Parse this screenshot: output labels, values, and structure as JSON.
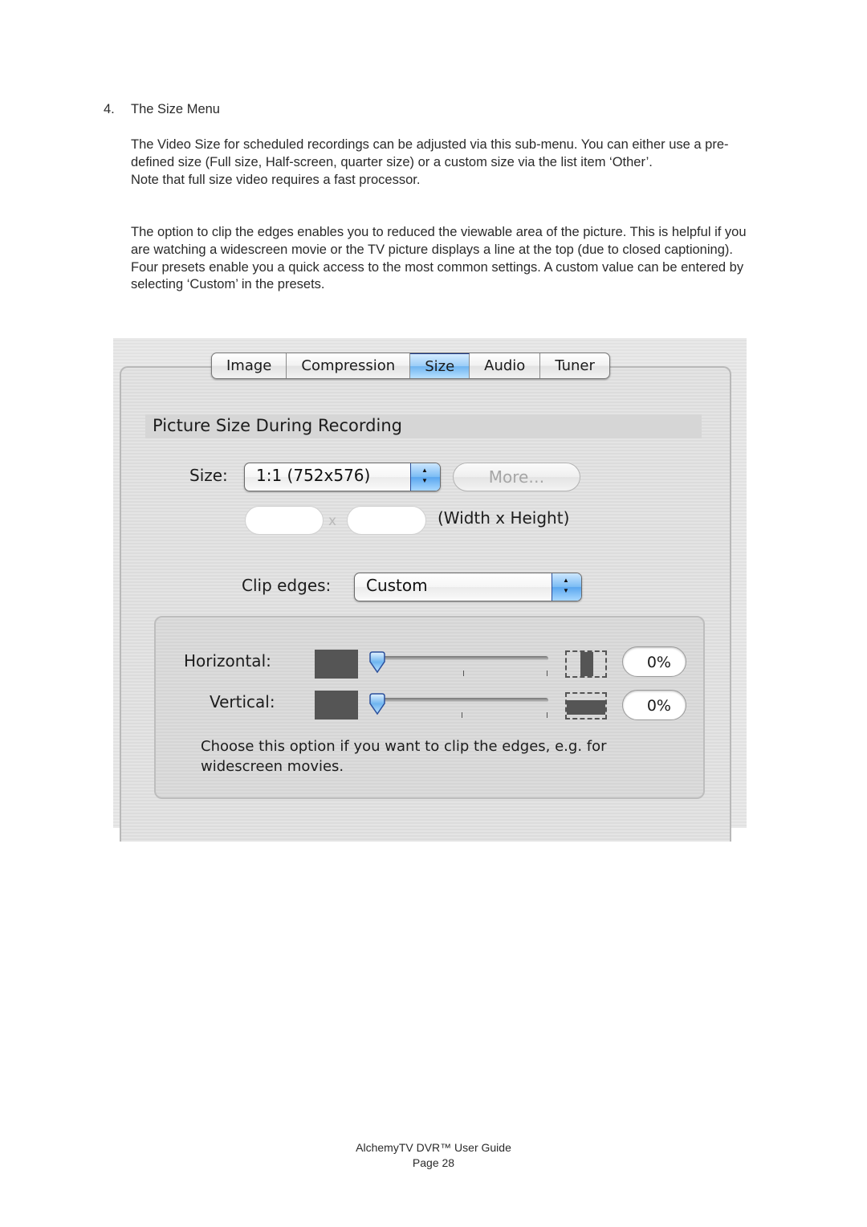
{
  "document": {
    "heading_number": "4.",
    "heading": "The Size Menu",
    "paragraphs": [
      "The Video Size for scheduled recordings can be adjusted via this sub-menu. You can either use a pre-defined size (Full size, Half-screen, quarter size) or a custom size via the list item ‘Other’.",
      "Note that full size video requires a fast processor.",
      "The option to clip the edges enables you to reduced the viewable area of the picture. This is helpful if you are watching a widescreen movie or the TV picture displays a line at the top (due to closed captioning).",
      "Four presets enable you a quick access to the most common settings. A custom value can be entered by selecting ‘Custom’ in the presets."
    ]
  },
  "dialog": {
    "tabs": [
      {
        "label": "Image",
        "active": false
      },
      {
        "label": "Compression",
        "active": false
      },
      {
        "label": "Size",
        "active": true
      },
      {
        "label": "Audio",
        "active": false
      },
      {
        "label": "Tuner",
        "active": false
      }
    ],
    "section_title": "Picture Size During Recording",
    "size_label": "Size:",
    "size_value": "1:1 (752x576)",
    "more_button": "More…",
    "width_value": "",
    "height_value": "",
    "dim_separator": "x",
    "dim_hint": "(Width x Height)",
    "clip_label": "Clip edges:",
    "clip_value": "Custom",
    "horizontal_label": "Horizontal:",
    "horizontal_value": "0%",
    "horizontal_fraction": 0,
    "vertical_label": "Vertical:",
    "vertical_value": "0%",
    "vertical_fraction": 0,
    "hint": "Choose this option if you want to clip the edges, e.g. for widescreen movies.",
    "colors": {
      "accent": "#6fb5f0",
      "swatch": "#555555"
    }
  },
  "footer": {
    "title": "AlchemyTV DVR™ User Guide",
    "page": "Page 28"
  }
}
